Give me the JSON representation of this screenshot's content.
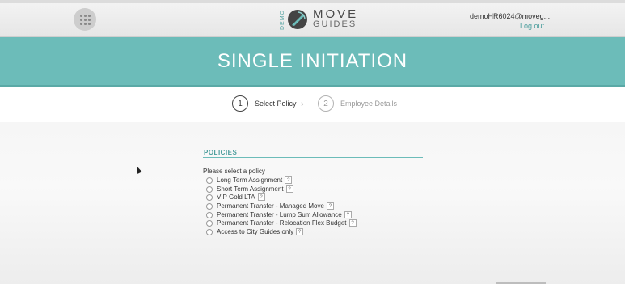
{
  "header": {
    "apps_icon": "grid-icon",
    "logo": {
      "demo": "DEMO",
      "line1": "MOVE",
      "line2": "GUIDES"
    },
    "user_email": "demoHR6024@moveg...",
    "logout_label": "Log out"
  },
  "banner": {
    "title": "SINGLE INITIATION"
  },
  "steps": [
    {
      "number": "1",
      "label": "Select Policy",
      "state": "active"
    },
    {
      "number": "2",
      "label": "Employee Details",
      "state": "inactive"
    }
  ],
  "steps_separator": "chevron-right-icon",
  "policies": {
    "section_title": "POLICIES",
    "prompt": "Please select a policy",
    "help_glyph": "?",
    "options": [
      {
        "label": "Long Term Assignment",
        "selected": false
      },
      {
        "label": "Short Term Assignment",
        "selected": false
      },
      {
        "label": "VIP Gold LTA",
        "selected": false
      },
      {
        "label": "Permanent Transfer - Managed Move",
        "selected": false
      },
      {
        "label": "Permanent Transfer - Lump Sum Allowance",
        "selected": false
      },
      {
        "label": "Permanent Transfer - Relocation Flex Budget",
        "selected": false
      },
      {
        "label": "Access to City Guides only",
        "selected": false
      }
    ]
  },
  "colors": {
    "teal": "#6cbcb9",
    "teal_dark": "#4a9d9c",
    "header_bg": "#eeeeee"
  }
}
